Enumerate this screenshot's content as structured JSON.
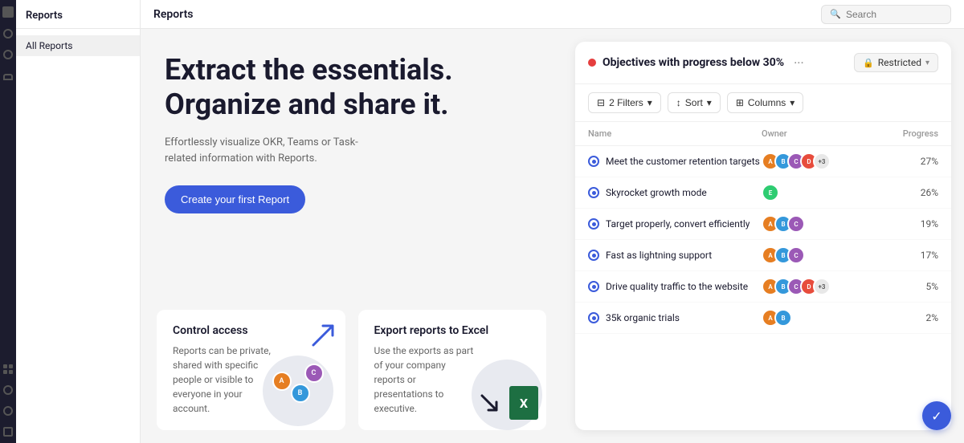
{
  "app": {
    "sidebar_title": "Reports",
    "nav_item": "All Reports",
    "top_bar_title": "Reports",
    "search_placeholder": "Search"
  },
  "hero": {
    "title": "Extract the essentials. Organize and share it.",
    "subtitle": "Effortlessly visualize OKR, Teams or Task-related information with Reports.",
    "cta_label": "Create your first Report"
  },
  "report_card": {
    "title": "Objectives with progress below 30%",
    "restricted_label": "Restricted",
    "filters_label": "2 Filters",
    "sort_label": "Sort",
    "columns_label": "Columns",
    "columns": [
      {
        "label": "Name"
      },
      {
        "label": "Owner"
      },
      {
        "label": "Progress"
      }
    ],
    "rows": [
      {
        "name": "Meet the customer retention targets",
        "owners": [
          "#e67e22",
          "#3498db",
          "#9b59b6",
          "#e74c3c"
        ],
        "extra": "+3",
        "progress": "27%"
      },
      {
        "name": "Skyrocket growth mode",
        "owners": [
          "#2ecc71"
        ],
        "extra": null,
        "progress": "26%"
      },
      {
        "name": "Target properly, convert efficiently",
        "owners": [
          "#e67e22",
          "#3498db",
          "#9b59b6"
        ],
        "extra": null,
        "progress": "19%"
      },
      {
        "name": "Fast as lightning support",
        "owners": [
          "#e67e22",
          "#3498db",
          "#9b59b6"
        ],
        "extra": null,
        "progress": "17%"
      },
      {
        "name": "Drive quality traffic to the website",
        "owners": [
          "#e67e22",
          "#3498db",
          "#9b59b6",
          "#e74c3c"
        ],
        "extra": "+3",
        "progress": "5%"
      },
      {
        "name": "35k organic trials",
        "owners": [
          "#e67e22",
          "#3498db"
        ],
        "extra": null,
        "progress": "2%"
      }
    ]
  },
  "feature_cards": [
    {
      "title": "Control access",
      "description": "Reports can be private, shared with specific people or visible to everyone in your account."
    },
    {
      "title": "Export reports to Excel",
      "description": "Use the exports as part of your company reports or presentations to executive."
    }
  ],
  "icons": {
    "search": "🔍",
    "lock": "🔒",
    "chevron_down": "▾",
    "filter": "⊟",
    "sort": "↕",
    "columns": "⊞",
    "more": "···",
    "fab": "✓"
  }
}
